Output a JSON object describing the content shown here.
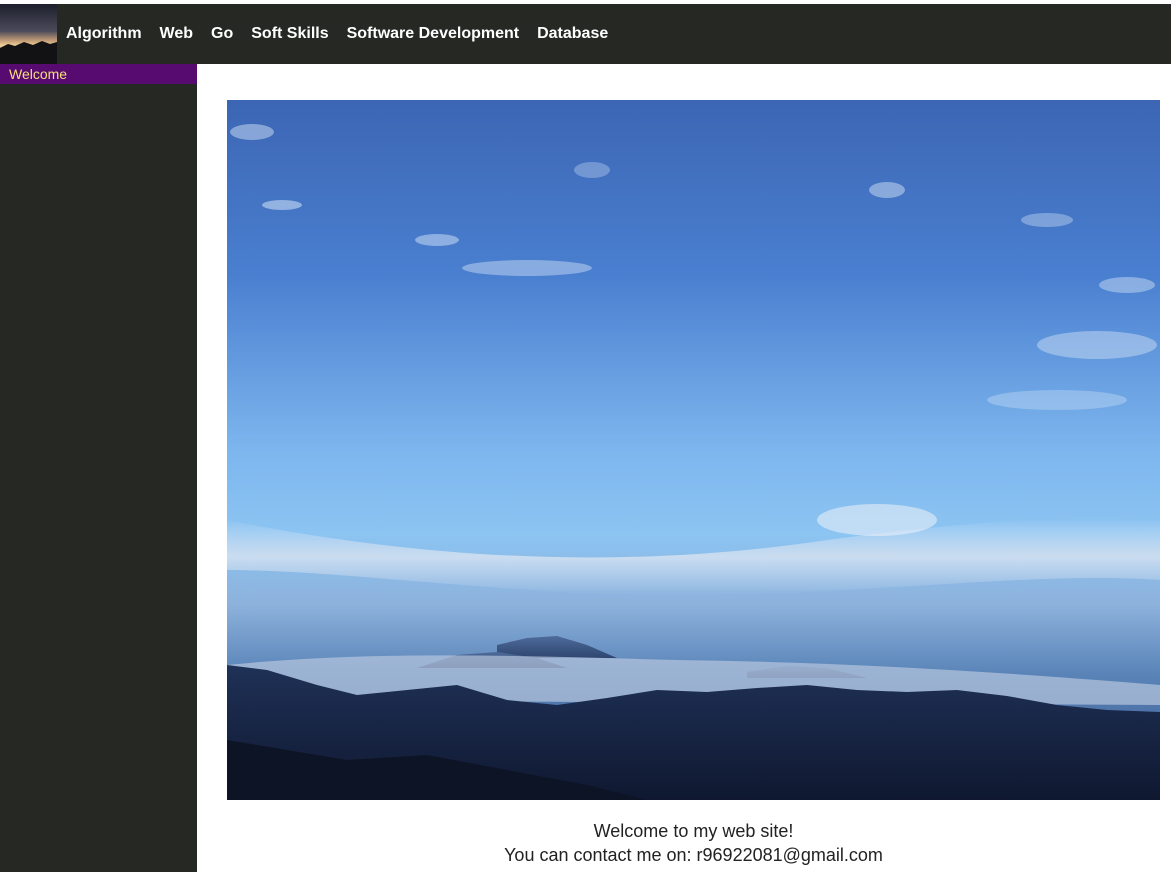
{
  "navbar": {
    "logo_icon": "mountain-sunset-logo-icon",
    "links": [
      {
        "label": "Algorithm"
      },
      {
        "label": "Web"
      },
      {
        "label": "Go"
      },
      {
        "label": "Soft Skills"
      },
      {
        "label": "Software Development"
      },
      {
        "label": "Database"
      }
    ]
  },
  "sidebar": {
    "items": [
      {
        "label": "Welcome",
        "active": true
      }
    ]
  },
  "main": {
    "hero_image": "mountain-sky-photo",
    "welcome_text": "Welcome to my web site!",
    "contact_text": "You can contact me on: r96922081@gmail.com"
  },
  "colors": {
    "nav_bg": "#252823",
    "sidebar_bg": "#252823",
    "sidebar_active_bg": "#570a6f",
    "sidebar_active_text": "#f3e07b",
    "nav_text": "#ffffff"
  }
}
